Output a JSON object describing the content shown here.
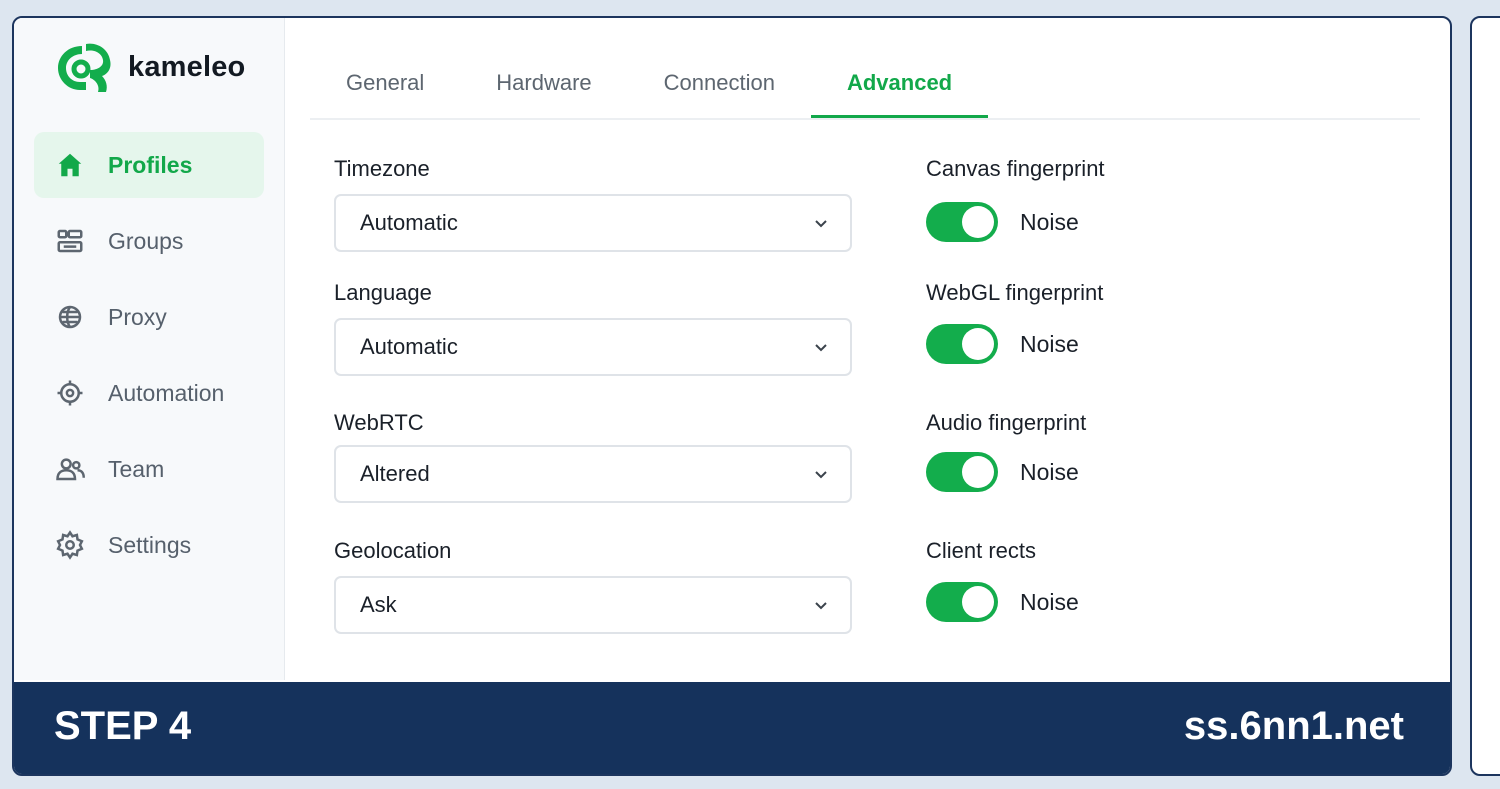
{
  "brand": {
    "name": "kameleo",
    "accent_color": "#12a84a"
  },
  "sidebar": {
    "items": [
      {
        "label": "Profiles",
        "icon": "home-icon",
        "active": true
      },
      {
        "label": "Groups",
        "icon": "groups-icon",
        "active": false
      },
      {
        "label": "Proxy",
        "icon": "globe-icon",
        "active": false
      },
      {
        "label": "Automation",
        "icon": "automation-icon",
        "active": false
      },
      {
        "label": "Team",
        "icon": "team-icon",
        "active": false
      },
      {
        "label": "Settings",
        "icon": "gear-icon",
        "active": false
      }
    ]
  },
  "tabs": [
    {
      "label": "General",
      "active": false
    },
    {
      "label": "Hardware",
      "active": false
    },
    {
      "label": "Connection",
      "active": false
    },
    {
      "label": "Advanced",
      "active": true
    }
  ],
  "fields": [
    {
      "label": "Timezone",
      "value": "Automatic"
    },
    {
      "label": "Language",
      "value": "Automatic"
    },
    {
      "label": "WebRTC",
      "value": "Altered"
    },
    {
      "label": "Geolocation",
      "value": "Ask"
    }
  ],
  "toggles": [
    {
      "label": "Canvas fingerprint",
      "state_text": "Noise",
      "on": true
    },
    {
      "label": "WebGL fingerprint",
      "state_text": "Noise",
      "on": true
    },
    {
      "label": "Audio fingerprint",
      "state_text": "Noise",
      "on": true
    },
    {
      "label": "Client rects",
      "state_text": "Noise",
      "on": true
    }
  ],
  "banner": {
    "step": "STEP 4",
    "site": "ss.6nn1.net",
    "color": "#15325c"
  }
}
